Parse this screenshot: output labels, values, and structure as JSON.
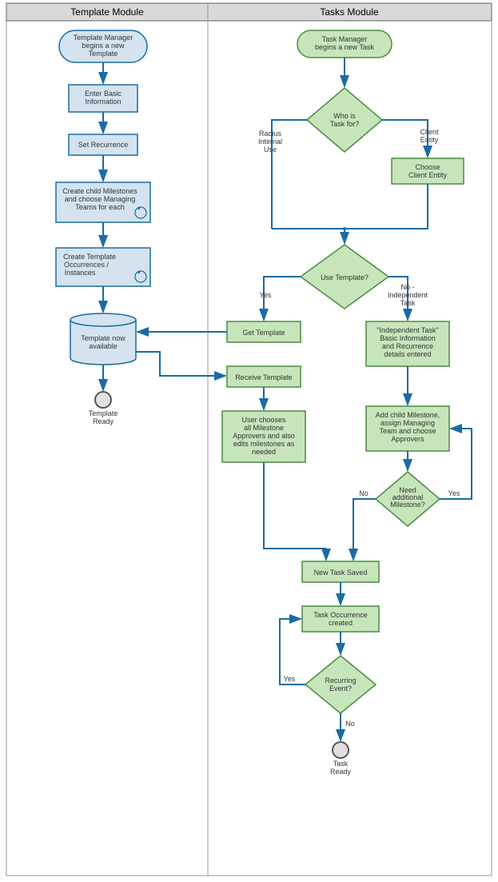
{
  "swimlanes": {
    "left_header": "Template Module",
    "right_header": "Tasks Module"
  },
  "template_module": {
    "start": "Template Manager\nbegins a new\nTemplate",
    "enter_info": "Enter Basic\nInformation",
    "set_recurrence": "Set Recurrence",
    "create_milestones": "Create child Milestones\nand choose Managing\nTeams for each",
    "create_occurrences": "Create Template\nOccurrences /\nInstances",
    "template_available": "Template now\navailable",
    "end": "Template\nReady"
  },
  "tasks_module": {
    "start": "Task Manager\nbegins a new Task",
    "who_for": "Who is\nTask for?",
    "who_for_left": "Radius\nInternal\nUse",
    "who_for_right": "Client\nEntity",
    "choose_client": "Choose\nClient Entity",
    "use_template": "Use Template?",
    "use_template_yes": "Yes",
    "use_template_no": "No -\nIndependent\nTask",
    "get_template": "Get Template",
    "receive_template": "Receive Template",
    "user_chooses": "User chooses\nall Milestone\nApprovers and also\nedits milestones as\nneeded",
    "independent_task": "\"Independent Task\"\nBasic Information\nand Recurrence\ndetails entered",
    "add_milestone": "Add child Milestone,\nassign Managing\nTeam and choose\nApprovers",
    "need_additional": "Need\nadditional\nMilestone?",
    "need_additional_yes": "Yes",
    "need_additional_no": "No",
    "new_task_saved": "New Task Saved",
    "task_occurrence": "Task Occurrence\ncreated",
    "recurring": "Recurring\nEvent?",
    "recurring_yes": "Yes",
    "recurring_no": "No",
    "end": "Task\nReady"
  },
  "colors": {
    "blue_fill": "#d4e3ef",
    "blue_stroke": "#1a6ba5",
    "green_fill": "#c7e5bb",
    "green_stroke": "#4a8b3f",
    "header_fill": "#d9d9d9",
    "arrow": "#1a6ba5"
  },
  "diagram_type": "swimlane-flowchart"
}
